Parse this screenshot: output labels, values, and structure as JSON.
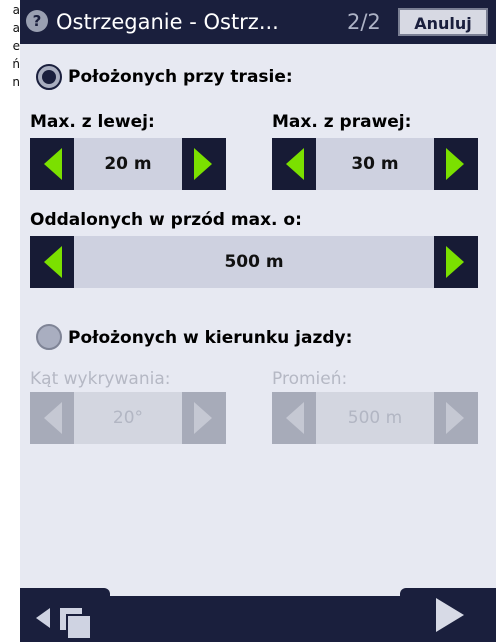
{
  "left_overflow": [
    "a",
    "a",
    "e",
    "ń",
    "n"
  ],
  "header": {
    "title": "Ostrzeganie - Ostrz...",
    "page": "2/2",
    "cancel": "Anuluj",
    "help_glyph": "?"
  },
  "section_along_route": {
    "label": "Położonych przy trasie:",
    "selected": true,
    "max_left_label": "Max. z lewej:",
    "max_left_value": "20 m",
    "max_right_label": "Max. z prawej:",
    "max_right_value": "30 m",
    "ahead_label": "Oddalonych w przód max. o:",
    "ahead_value": "500 m"
  },
  "section_direction": {
    "label": "Położonych w kierunku jazdy:",
    "selected": false,
    "angle_label": "Kąt wykrywania:",
    "angle_value": "20°",
    "radius_label": "Promień:",
    "radius_value": "500 m"
  },
  "colors": {
    "header": "#1a1f3d",
    "arrow": "#7be000",
    "panel": "#e7e9f2"
  },
  "icons": {
    "back": "arrow-left-icon",
    "windows": "windows-icon",
    "forward": "arrow-right-icon"
  }
}
